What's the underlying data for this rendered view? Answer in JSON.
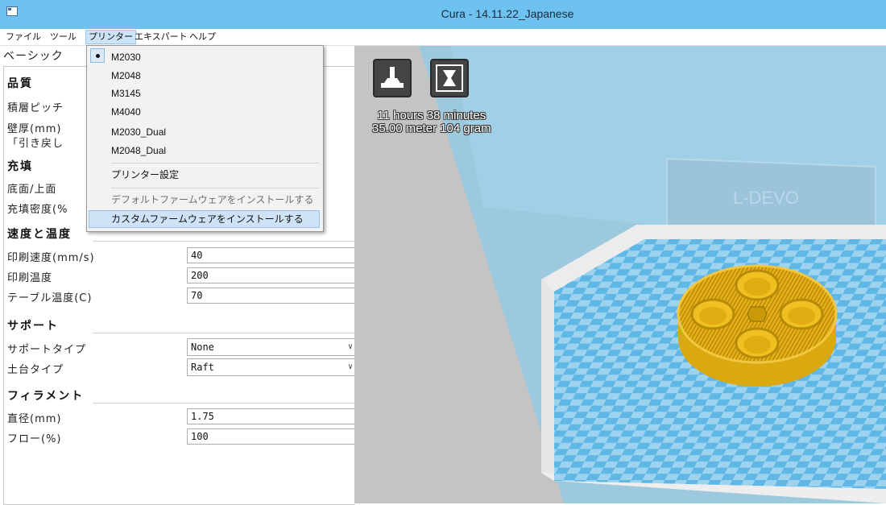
{
  "window": {
    "title": "Cura - 14.11.22_Japanese"
  },
  "menubar": {
    "items": [
      {
        "label": "ファイル"
      },
      {
        "label": "ツール"
      },
      {
        "label": "プリンター"
      },
      {
        "label": "エキスパート"
      },
      {
        "label": "ヘルプ"
      }
    ]
  },
  "printer_menu": {
    "items": [
      {
        "label": "M2030",
        "selected": true
      },
      {
        "label": "M2048"
      },
      {
        "label": "M3145"
      },
      {
        "label": "M4040"
      },
      {
        "label": "M2030_Dual"
      },
      {
        "label": "M2048_Dual"
      }
    ],
    "printer_settings": "プリンター設定",
    "install_default_firmware": "デフォルトファームウェアをインストールする",
    "install_custom_firmware": "カスタムファームウェアをインストールする"
  },
  "left_panel": {
    "tab": "ベーシック",
    "sections": {
      "quality": {
        "title": "品質",
        "rows": [
          "積層ピッチ",
          "壁厚(mm)",
          "「引き戻し"
        ]
      },
      "fill": {
        "title": "充填",
        "rows": [
          "底面/上面",
          "充填密度(%"
        ]
      },
      "speed": {
        "title": "速度と温度",
        "print_speed_label": "印刷速度(mm/s)",
        "print_speed": "40",
        "print_temp_label": "印刷温度",
        "print_temp": "200",
        "bed_temp_label": "テーブル温度(C)",
        "bed_temp": "70"
      },
      "support": {
        "title": "サポート",
        "support_type_label": "サポートタイプ",
        "support_type": "None",
        "platform_label": "土台タイプ",
        "platform": "Raft"
      },
      "filament": {
        "title": "フィラメント",
        "diameter_label": "直径(mm)",
        "diameter": "1.75",
        "flow_label": "フロー(%)",
        "flow": "100"
      }
    }
  },
  "viewport": {
    "stats_line1": "11 hours 38 minutes",
    "stats_line2": "35.00 meter 104 gram",
    "back_wall_text": "L-DEVO",
    "model_color": "#f0c020"
  }
}
